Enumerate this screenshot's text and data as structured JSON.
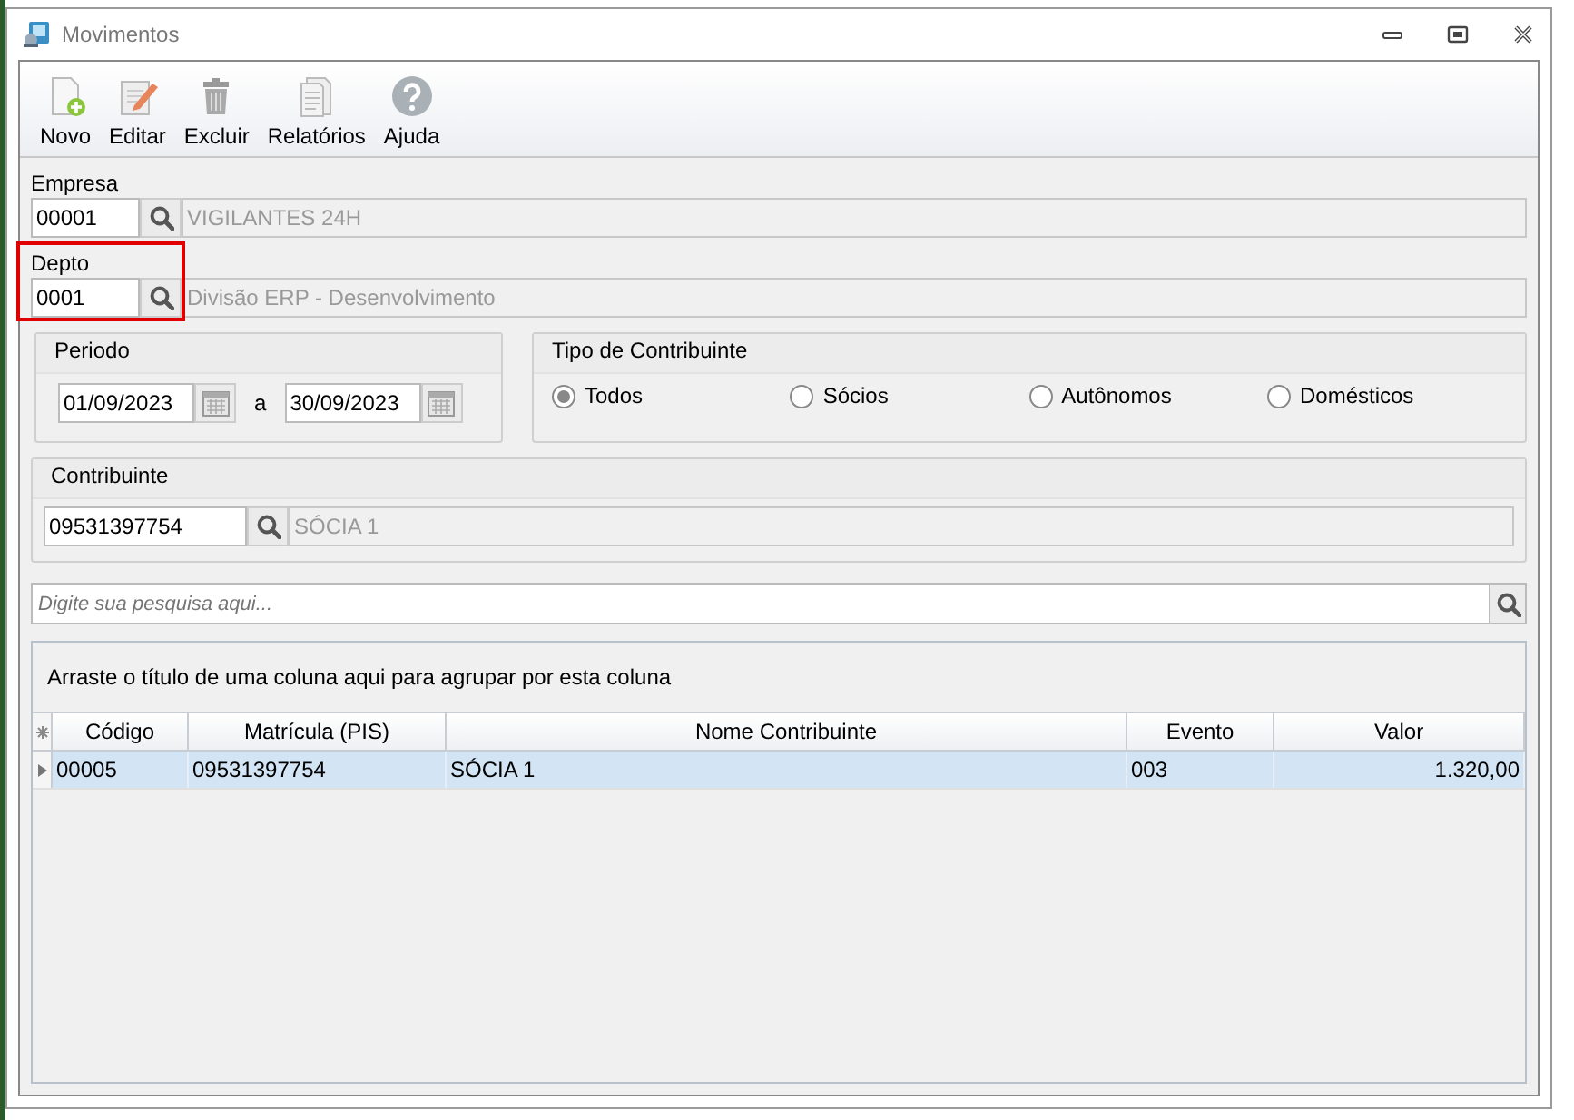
{
  "window": {
    "title": "Movimentos"
  },
  "toolbar": [
    {
      "kind": "new",
      "label": "Novo"
    },
    {
      "kind": "edit",
      "label": "Editar"
    },
    {
      "kind": "delete",
      "label": "Excluir"
    },
    {
      "kind": "report",
      "label": "Relatórios"
    },
    {
      "kind": "help",
      "label": "Ajuda"
    }
  ],
  "empresa": {
    "label": "Empresa",
    "code": "00001",
    "description": "VIGILANTES 24H"
  },
  "depto": {
    "label": "Depto",
    "code": "0001",
    "description": "Divisão ERP - Desenvolvimento",
    "highlighted": true
  },
  "periodo": {
    "title": "Periodo",
    "start": "01/09/2023",
    "separator": "a",
    "end": "30/09/2023"
  },
  "tipo_contribuinte": {
    "title": "Tipo de Contribuinte",
    "options": [
      {
        "label": "Todos",
        "selected": true
      },
      {
        "label": "Sócios",
        "selected": false
      },
      {
        "label": "Autônomos",
        "selected": false
      },
      {
        "label": "Domésticos",
        "selected": false
      }
    ]
  },
  "contribuinte": {
    "title": "Contribuinte",
    "code": "09531397754",
    "description": "SÓCIA 1"
  },
  "search": {
    "placeholder": "Digite sua pesquisa aqui..."
  },
  "grid": {
    "group_hint": "Arraste o título de uma coluna aqui para agrupar por esta coluna",
    "columns": [
      "Código",
      "Matrícula (PIS)",
      "Nome Contribuinte",
      "Evento",
      "Valor"
    ],
    "rows": [
      {
        "selected": true,
        "cells": [
          "00005",
          "09531397754",
          "SÓCIA 1",
          "003",
          "1.320,00"
        ]
      }
    ]
  }
}
